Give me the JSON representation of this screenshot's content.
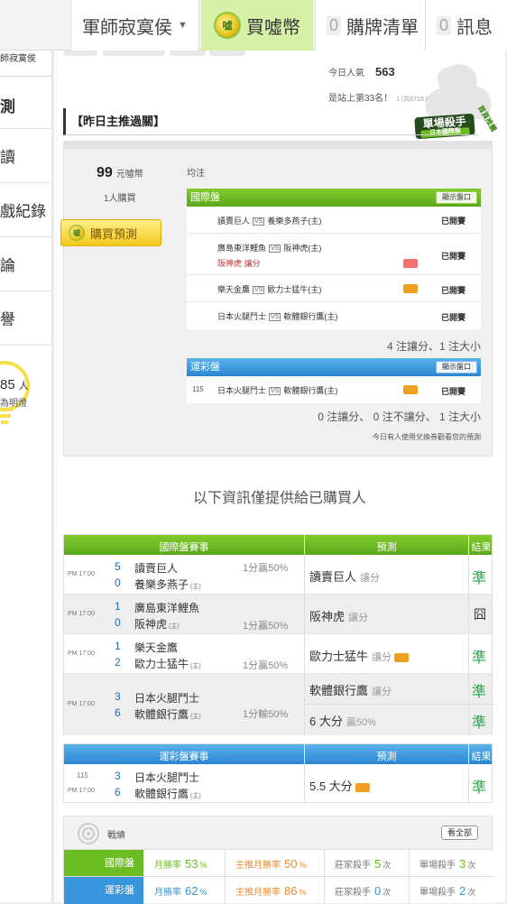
{
  "topbar": {
    "user": "軍師寂寞侯",
    "buy": "買噓幣",
    "cart_count": "0",
    "cart": "購牌清單",
    "msg_count": "0",
    "msg": "訊息",
    "coin_text": "噓"
  },
  "sidebar": {
    "top_text": "師寂寞侯",
    "items": [
      "測",
      "讀",
      "戲紀錄",
      "論",
      "譽"
    ],
    "count": "85",
    "count_unit": "人",
    "count_sub": "為明燈"
  },
  "stats": {
    "popularity_label": "今日人氣",
    "popularity_value": "563",
    "rank": "是站上第33名！",
    "rank_small": "1 (共6716人)"
  },
  "badge": {
    "title": "單場殺手",
    "sub": "日本國際盤",
    "corner": "首頁推薦"
  },
  "section_title": "【昨日主推過關】",
  "pick": {
    "price": "99",
    "price_unit": "元噓幣",
    "buyers": "1人購買",
    "buy_button": "購買預測",
    "type": "均注"
  },
  "intl_panel": {
    "title": "國際盤",
    "show_btn": "顯示盤口",
    "rows": [
      {
        "home": "讀賣巨人",
        "away": "養樂多燕子(主)",
        "tip": "",
        "status": "已開賽"
      },
      {
        "home": "廣島東洋鯉魚",
        "away": "阪神虎(主)",
        "tip": "阪神虎  讓分",
        "status": "已開賽"
      },
      {
        "home": "樂天金鷹",
        "away": "歐力士猛牛(主)",
        "tip": "",
        "status": "已開賽"
      },
      {
        "home": "日本火腿鬥士",
        "away": "軟體銀行鷹(主)",
        "tip": "",
        "status": "已開賽"
      }
    ],
    "summary": "4 注讓分、1 注大小"
  },
  "lottery_panel": {
    "title": "運彩盤",
    "show_btn": "顯示盤口",
    "rows": [
      {
        "num": "115",
        "home": "日本火腿鬥士",
        "away": "軟體銀行鷹(主)",
        "status": "已開賽"
      }
    ],
    "summary": "0 注讓分、 0 注不讓分、 1 注大小",
    "note": "今日有人使用兌換券觀看您的預測"
  },
  "buyer_title": "以下資訊僅提供給已購買人",
  "intl_table": {
    "headers": [
      "國際盤賽事",
      "預測",
      "結果"
    ],
    "rows": [
      {
        "time": "PM 17:00",
        "s1": "5",
        "t1": "讀賣巨人",
        "s2": "0",
        "t2": "養樂多燕子",
        "line": "1分贏50%",
        "pred": "讀賣巨人",
        "pred_type": "讓分",
        "result": "準"
      },
      {
        "time": "PM 17:00",
        "s1": "1",
        "t1": "廣島東洋鯉魚",
        "s2": "0",
        "t2": "阪神虎",
        "line": "1分贏50%",
        "pred": "阪神虎",
        "pred_type": "讓分",
        "result": "囧"
      },
      {
        "time": "PM 17:00",
        "s1": "1",
        "t1": "樂天金鷹",
        "s2": "2",
        "t2": "歐力士猛牛",
        "line": "1分贏50%",
        "pred": "歐力士猛牛",
        "pred_type": "讓分",
        "result": "準"
      },
      {
        "time": "PM 17:00",
        "s1": "3",
        "t1": "日本火腿鬥士",
        "s2": "6",
        "t2": "軟體銀行鷹",
        "line": "1分輸50%",
        "pred": "軟體銀行鷹",
        "pred_type": "讓分",
        "result": "準",
        "pred2": "6 大分",
        "pred2_extra": "贏50%",
        "result2": "準"
      }
    ],
    "home_tag": "(主)"
  },
  "lottery_table": {
    "headers": [
      "運彩盤賽事",
      "預測",
      "結果"
    ],
    "rows": [
      {
        "num": "115",
        "time": "PM 17:00",
        "s1": "3",
        "t1": "日本火腿鬥士",
        "s2": "6",
        "t2": "軟體銀行鷹",
        "pred": "5.5 大分",
        "result": "準"
      }
    ]
  },
  "record": {
    "title": "戰績",
    "view_all": "看全部",
    "rows": [
      {
        "label": "國際盤",
        "m1": "月勝率",
        "v1": "53",
        "p1": "%",
        "m2": "主推月勝率",
        "v2": "50",
        "p2": "%",
        "m3": "莊家殺手",
        "v3": "5",
        "u3": "次",
        "m4": "單場殺手",
        "v4": "3",
        "u4": "次"
      },
      {
        "label": "運彩盤",
        "m1": "月勝率",
        "v1": "62",
        "p1": "%",
        "m2": "主推月勝率",
        "v2": "86",
        "p2": "%",
        "m3": "莊家殺手",
        "v3": "0",
        "u3": "次",
        "m4": "單場殺手",
        "v4": "2",
        "u4": "次"
      }
    ]
  },
  "colors": {
    "green": "#6bbd22",
    "blue": "#3a96dc",
    "orange": "#f0a020"
  }
}
